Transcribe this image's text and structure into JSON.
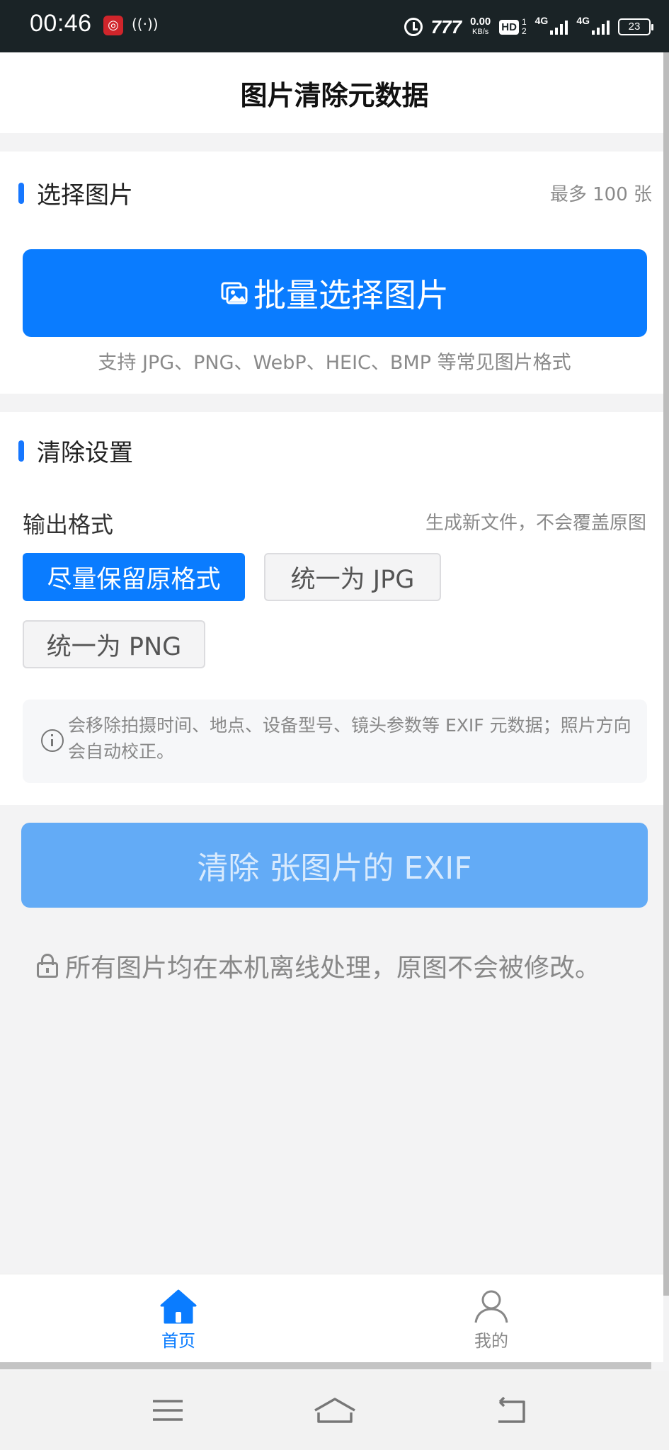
{
  "status_bar": {
    "time": "00:46",
    "speed_value": "0.00",
    "speed_unit": "KB/s",
    "hd_label": "HD",
    "hd_sub_top": "1",
    "hd_sub_bottom": "2",
    "net1": "4G",
    "net2": "4G",
    "carrier_badge": "777",
    "battery": "23"
  },
  "header": {
    "title": "图片清除元数据"
  },
  "select_section": {
    "title": "选择图片",
    "limit_note": "最多 100 张",
    "button_label": "批量选择图片",
    "support_text": "支持 JPG、PNG、WebP、HEIC、BMP 等常见图片格式"
  },
  "settings_section": {
    "title": "清除设置",
    "output_label": "输出格式",
    "output_note": "生成新文件，不会覆盖原图",
    "options": [
      {
        "label": "尽量保留原格式",
        "selected": true
      },
      {
        "label": "统一为 JPG",
        "selected": false
      },
      {
        "label": "统一为 PNG",
        "selected": false
      }
    ],
    "info_text": "会移除拍摄时间、地点、设备型号、镜头参数等 EXIF 元数据；照片方向会自动校正。"
  },
  "action": {
    "clear_button": "清除 张图片的 EXIF",
    "privacy_text": "所有图片均在本机离线处理，原图不会被修改。"
  },
  "tabbar": {
    "tabs": [
      {
        "label": "首页",
        "icon": "home-icon",
        "active": true
      },
      {
        "label": "我的",
        "icon": "user-icon",
        "active": false
      }
    ]
  },
  "colors": {
    "primary": "#0a7cff",
    "disabled_primary": "#63abf6",
    "status_bar_bg": "#1a2326"
  }
}
